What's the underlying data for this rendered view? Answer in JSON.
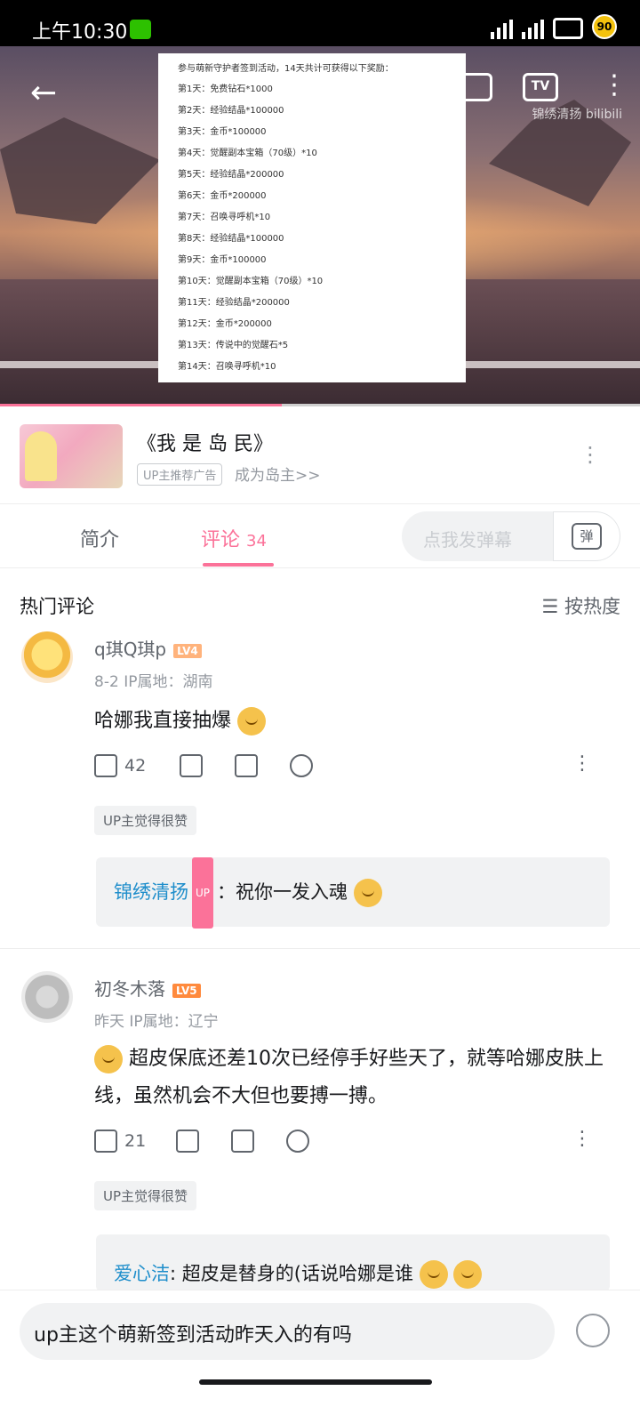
{
  "status_bar": {
    "time": "上午10:30",
    "battery": "90"
  },
  "video": {
    "watermark": "锦绣清扬 bilibili",
    "tv_label": "TV",
    "notice_header": "参与萌新守护者签到活动，14天共计可获得以下奖励：",
    "notice_lines": [
      "第1天：免费钻石*1000",
      "第2天：经验结晶*100000",
      "第3天：金币*100000",
      "第4天：觉醒副本宝箱（70级）*10",
      "第5天：经验结晶*200000",
      "第6天：金币*200000",
      "第7天：召唤寻呼机*10",
      "第8天：经验结晶*100000",
      "第9天：金币*100000",
      "第10天：觉醒副本宝箱（70级）*10",
      "第11天：经验结晶*200000",
      "第12天：金币*200000",
      "第13天：传说中的觉醒石*5",
      "第14天：召唤寻呼机*10"
    ],
    "progress_fraction": 0.44
  },
  "ad": {
    "title": "《我 是 岛 民》",
    "tag": "UP主推荐广告",
    "link": "成为岛主>>"
  },
  "tabs": {
    "intro": "简介",
    "comments": "评论",
    "comment_count": "34",
    "danmu_placeholder": "点我发弹幕",
    "danmu_button": "弹"
  },
  "comments_header": {
    "title": "热门评论",
    "sort": "按热度"
  },
  "comments": [
    {
      "user": "q琪Q琪p",
      "level": "LV4",
      "level_color": "#ffb37c",
      "date": "8-2",
      "ip": "IP属地：湖南",
      "text": "哈娜我直接抽爆",
      "likes": "42",
      "up_liked": "UP主觉得很赞",
      "reply": {
        "user": "锦绣清扬",
        "up_tag": "UP",
        "text": "：祝你一发入魂"
      }
    },
    {
      "user": "初冬木落",
      "level": "LV5",
      "level_color": "#ff8a3d",
      "date": "昨天",
      "ip": "IP属地：辽宁",
      "text": "超皮保底还差10次已经停手好些天了，就等哈娜皮肤上线，虽然机会不大但也要搏一搏。",
      "likes": "21",
      "up_liked": "UP主觉得很赞",
      "reply": {
        "user": "爱心洁",
        "text": ": 超皮是替身的(话说哈娜是谁"
      }
    }
  ],
  "bottom_input": {
    "value": "up主这个萌新签到活动昨天入的有吗"
  },
  "colors": {
    "accent": "#fb7299",
    "link_blue": "#1f8ecb"
  }
}
